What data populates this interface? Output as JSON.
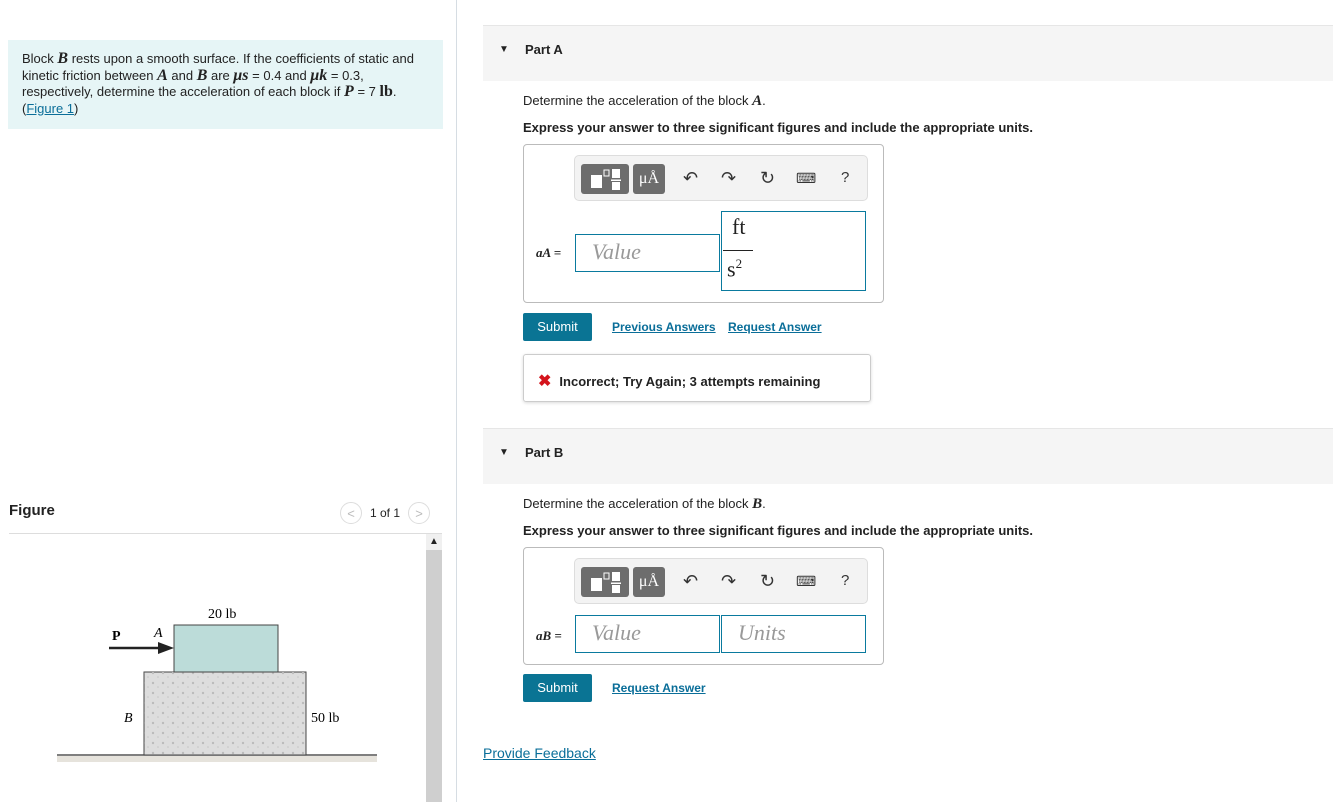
{
  "problem": {
    "t1": "Block ",
    "B": "B",
    "t2": " rests upon a smooth surface. If the coefficients of static and kinetic friction between ",
    "A": "A",
    "t3": " and ",
    "B2": "B",
    "t4": " are ",
    "mus": "μs",
    "t5": " = 0.4 and ",
    "muk": "μk",
    "t6": " = 0.3, respectively, determine the acceleration of each block if ",
    "P": "P",
    "t7": " = 7 ",
    "lb": "lb",
    "t8": ".",
    "figure_link": "Figure 1"
  },
  "figure": {
    "title": "Figure",
    "pager": "1 of 1",
    "labels": {
      "P": "P",
      "A": "A",
      "B": "B",
      "wA": "20 lb",
      "wB": "50 lb"
    }
  },
  "partA": {
    "label": "Part A",
    "question": "Determine the acceleration of the block ",
    "block": "A",
    "instr": "Express your answer to three significant figures and include the appropriate units.",
    "var": "aA =",
    "placeholder": "Value",
    "unit_num": "ft",
    "unit_den": "s",
    "unit_exp": "2",
    "submit": "Submit",
    "prev": "Previous Answers",
    "request": "Request Answer",
    "feedback": "Incorrect; Try Again; 3 attempts remaining"
  },
  "partB": {
    "label": "Part B",
    "question": "Determine the acceleration of the block ",
    "block": "B",
    "instr": "Express your answer to three significant figures and include the appropriate units.",
    "var": "aB =",
    "placeholder": "Value",
    "units_placeholder": "Units",
    "submit": "Submit",
    "request": "Request Answer"
  },
  "toolbar": {
    "units": "μÅ",
    "help": "?"
  },
  "provide_feedback": "Provide Feedback"
}
